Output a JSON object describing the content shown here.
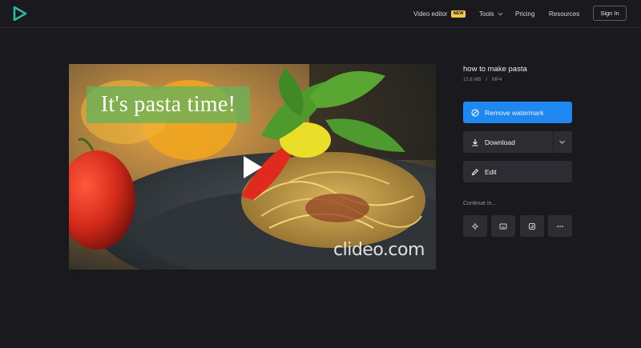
{
  "header": {
    "nav": {
      "video_editor": "Video editor",
      "new_badge": "NEW",
      "tools": "Tools",
      "pricing": "Pricing",
      "resources": "Resources"
    },
    "sign_in": "Sign In"
  },
  "preview": {
    "overlay_title": "It's pasta time!",
    "watermark": "clideo.com"
  },
  "file": {
    "name": "how to make pasta",
    "size": "15.8 MB",
    "separator": "/",
    "format": "MP4"
  },
  "actions": {
    "remove_watermark": "Remove watermark",
    "download": "Download",
    "edit": "Edit"
  },
  "continue": {
    "label": "Continue in..."
  },
  "colors": {
    "accent": "#1e88f0",
    "logo": "#2bb7a3",
    "badge": "#f2c94c"
  }
}
